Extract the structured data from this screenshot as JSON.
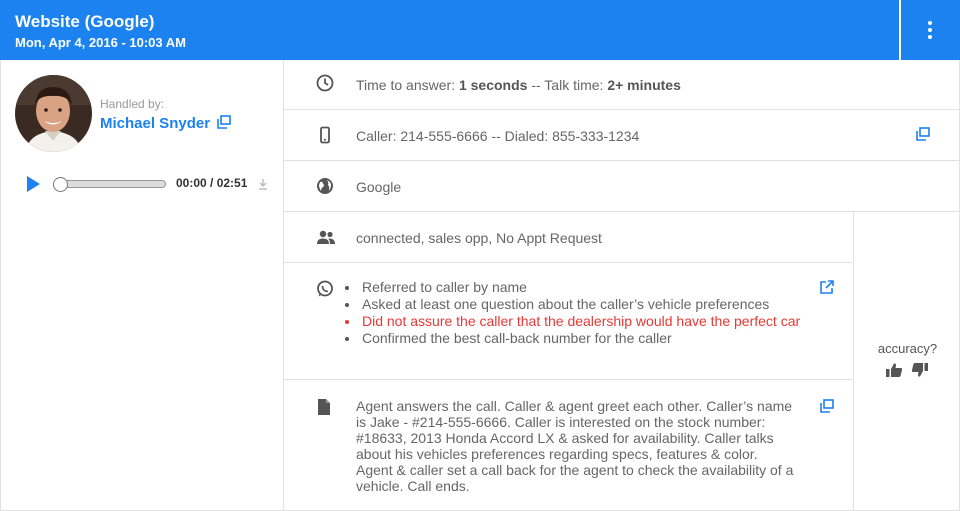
{
  "header": {
    "title": "Website (Google)",
    "subtitle": "Mon, Apr 4, 2016 - 10:03 AM",
    "menu_icon": "kebab-menu-icon"
  },
  "agent": {
    "handled_label": "Handled by:",
    "name": "Michael Snyder"
  },
  "player": {
    "time": "00:00 / 02:51",
    "progress": 0
  },
  "rows": {
    "timing": {
      "answer_label": "Time to answer: ",
      "answer_value": "1 seconds",
      "separator": " -- Talk time: ",
      "talk_value": "2+ minutes"
    },
    "caller": "Caller: 214-555-6666 -- Dialed: 855-333-1234",
    "source": "Google",
    "tags": "connected, sales opp, No Appt Request",
    "checklist": [
      {
        "text": "Referred to caller by name",
        "status": "pass"
      },
      {
        "text": "Asked at least one question about the caller’s vehicle preferences",
        "status": "pass"
      },
      {
        "text": "Did not assure the caller that the dealership would have the perfect car",
        "status": "fail"
      },
      {
        "text": "Confirmed the best call-back number for the caller",
        "status": "pass"
      }
    ],
    "summary": "Agent answers the call. Caller & agent greet each other. Caller’s name is Jake - #214-555-6666. Caller is interested on the stock number: #18633, 2013 Honda Accord LX & asked for availability. Caller talks about his vehicles preferences regarding specs, features & color. Agent & caller set a call back for the agent to check the availability of a vehicle. Call ends."
  },
  "accuracy": {
    "label": "accuracy?"
  },
  "colors": {
    "brand": "#1b82f0",
    "negative": "#e53935"
  }
}
